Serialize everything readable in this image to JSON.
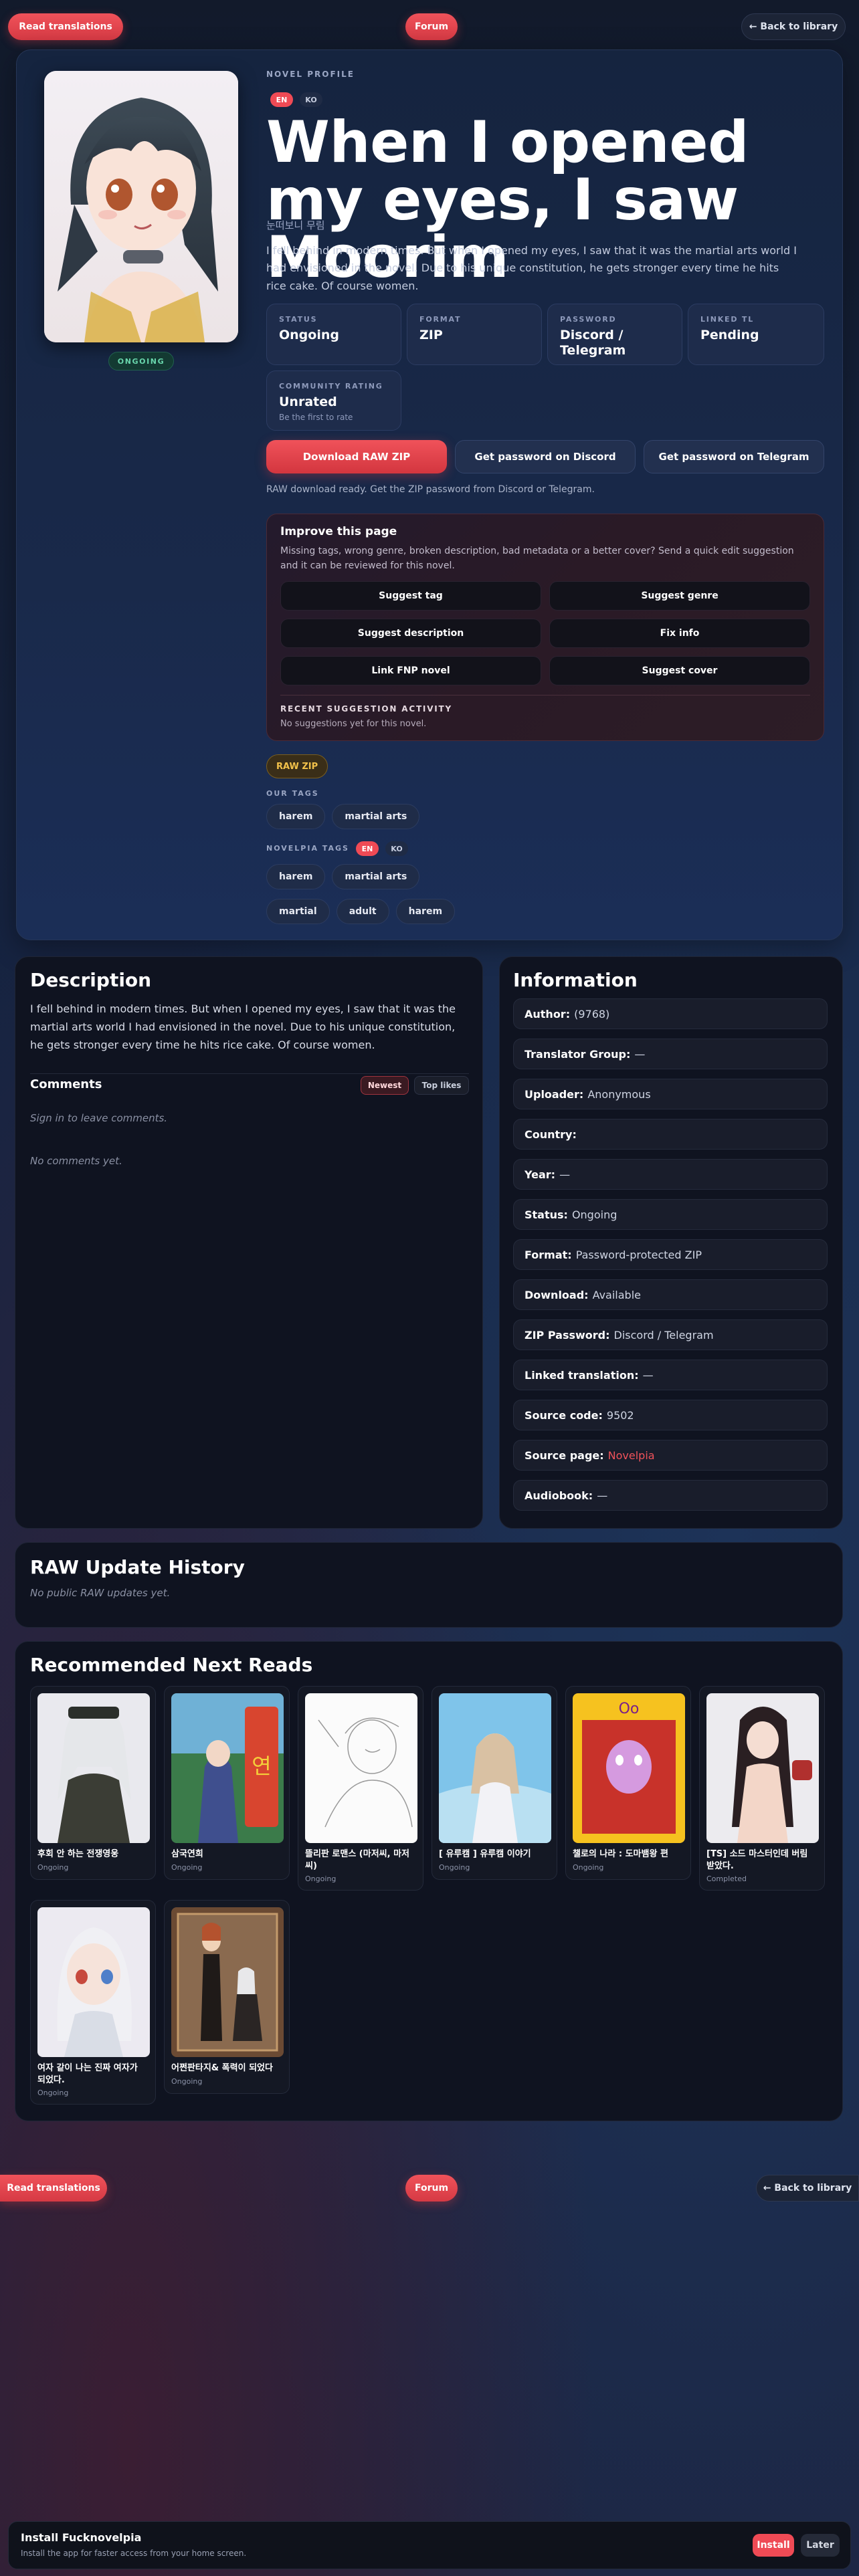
{
  "nav": {
    "read_translations": "Read translations",
    "forum": "Forum",
    "back_to_library": "← Back to library"
  },
  "hero": {
    "kicker": "NOVEL PROFILE",
    "lang_en": "EN",
    "lang_ko": "KO",
    "title": "When I opened my eyes, I saw Moorim",
    "subtitle": "눈떠보니 무림",
    "synopsis": "I fell behind in modern times. But when I opened my eyes, I saw that it was the martial arts world I had envisioned in the novel. Due to his unique constitution, he gets stronger every time he hits rice cake. Of course women.",
    "cover_status": "ONGOING",
    "stats": [
      {
        "label": "STATUS",
        "value": "Ongoing"
      },
      {
        "label": "FORMAT",
        "value": "ZIP"
      },
      {
        "label": "PASSWORD",
        "value": "Discord / Telegram"
      },
      {
        "label": "LINKED TL",
        "value": "Pending"
      },
      {
        "label": "COMMUNITY RATING",
        "value": "Unrated",
        "sub": "Be the first to rate"
      }
    ],
    "download_btn": "Download RAW ZIP",
    "discord_btn": "Get password on Discord",
    "telegram_btn": "Get password on Telegram",
    "download_note": "RAW download ready. Get the ZIP password from Discord or Telegram."
  },
  "improve": {
    "title": "Improve this page",
    "desc": "Missing tags, wrong genre, broken description, bad metadata or a better cover? Send a quick edit suggestion and it can be reviewed for this novel.",
    "buttons": [
      "Suggest tag",
      "Suggest genre",
      "Suggest description",
      "Fix info",
      "Link FNP novel",
      "Suggest cover"
    ],
    "recent_label": "RECENT SUGGESTION ACTIVITY",
    "recent_text": "No suggestions yet for this novel."
  },
  "tags": {
    "raw_zip": "RAW ZIP",
    "our_tags_label": "OUR TAGS",
    "our_tags": [
      "harem",
      "martial arts"
    ],
    "novelpia_label": "NOVELPIA TAGS",
    "novelpia_en": "EN",
    "novelpia_ko": "KO",
    "novelpia_tags_row1": [
      "harem",
      "martial arts"
    ],
    "novelpia_tags_row2": [
      "martial",
      "adult",
      "harem"
    ]
  },
  "description": {
    "title": "Description",
    "text": "I fell behind in modern times. But when I opened my eyes, I saw that it was the martial arts world I had envisioned in the novel. Due to his unique constitution, he gets stronger every time he hits rice cake. Of course women."
  },
  "comments": {
    "title": "Comments",
    "sort_newest": "Newest",
    "sort_top": "Top likes",
    "signin": "Sign in to leave comments.",
    "empty": "No comments yet."
  },
  "information": {
    "title": "Information",
    "rows": [
      {
        "k": "Author:",
        "v": "(9768)"
      },
      {
        "k": "Translator Group:",
        "v": "—"
      },
      {
        "k": "Uploader:",
        "v": "Anonymous"
      },
      {
        "k": "Country:",
        "v": ""
      },
      {
        "k": "Year:",
        "v": "—"
      },
      {
        "k": "Status:",
        "v": "Ongoing"
      },
      {
        "k": "Format:",
        "v": "Password-protected ZIP"
      },
      {
        "k": "Download:",
        "v": "Available"
      },
      {
        "k": "ZIP Password:",
        "v": "Discord / Telegram"
      },
      {
        "k": "Linked translation:",
        "v": "—"
      },
      {
        "k": "Source code:",
        "v": "9502"
      },
      {
        "k": "Source page:",
        "v": "Novelpia",
        "link": true
      },
      {
        "k": "Audiobook:",
        "v": "—"
      }
    ]
  },
  "raw_history": {
    "title": "RAW Update History",
    "empty": "No public RAW updates yet."
  },
  "recommended": {
    "title": "Recommended Next Reads",
    "items": [
      {
        "title": "후회 안 하는 전쟁영웅",
        "status": "Ongoing"
      },
      {
        "title": "삼국연희",
        "status": "Ongoing"
      },
      {
        "title": "뜰리판 로맨스 (마저씨, 마저 씨)",
        "status": "Ongoing"
      },
      {
        "title": "[ 유루캠 ] 유루캠 이야기",
        "status": "Ongoing"
      },
      {
        "title": "챌로의 나라 : 도마뱀왕 편",
        "status": "Ongoing"
      },
      {
        "title": "[TS] 소드 마스터인데 버림 받았다.",
        "status": "Completed"
      },
      {
        "title": "여자 같이 나는 진짜 여자가 되었다.",
        "status": "Ongoing"
      },
      {
        "title": "어쩐판타지& 폭력이 되었다",
        "status": "Ongoing"
      }
    ]
  },
  "install": {
    "title": "Install Fucknovelpia",
    "desc": "Install the app for faster access from your home screen.",
    "install_btn": "Install",
    "later_btn": "Later"
  }
}
